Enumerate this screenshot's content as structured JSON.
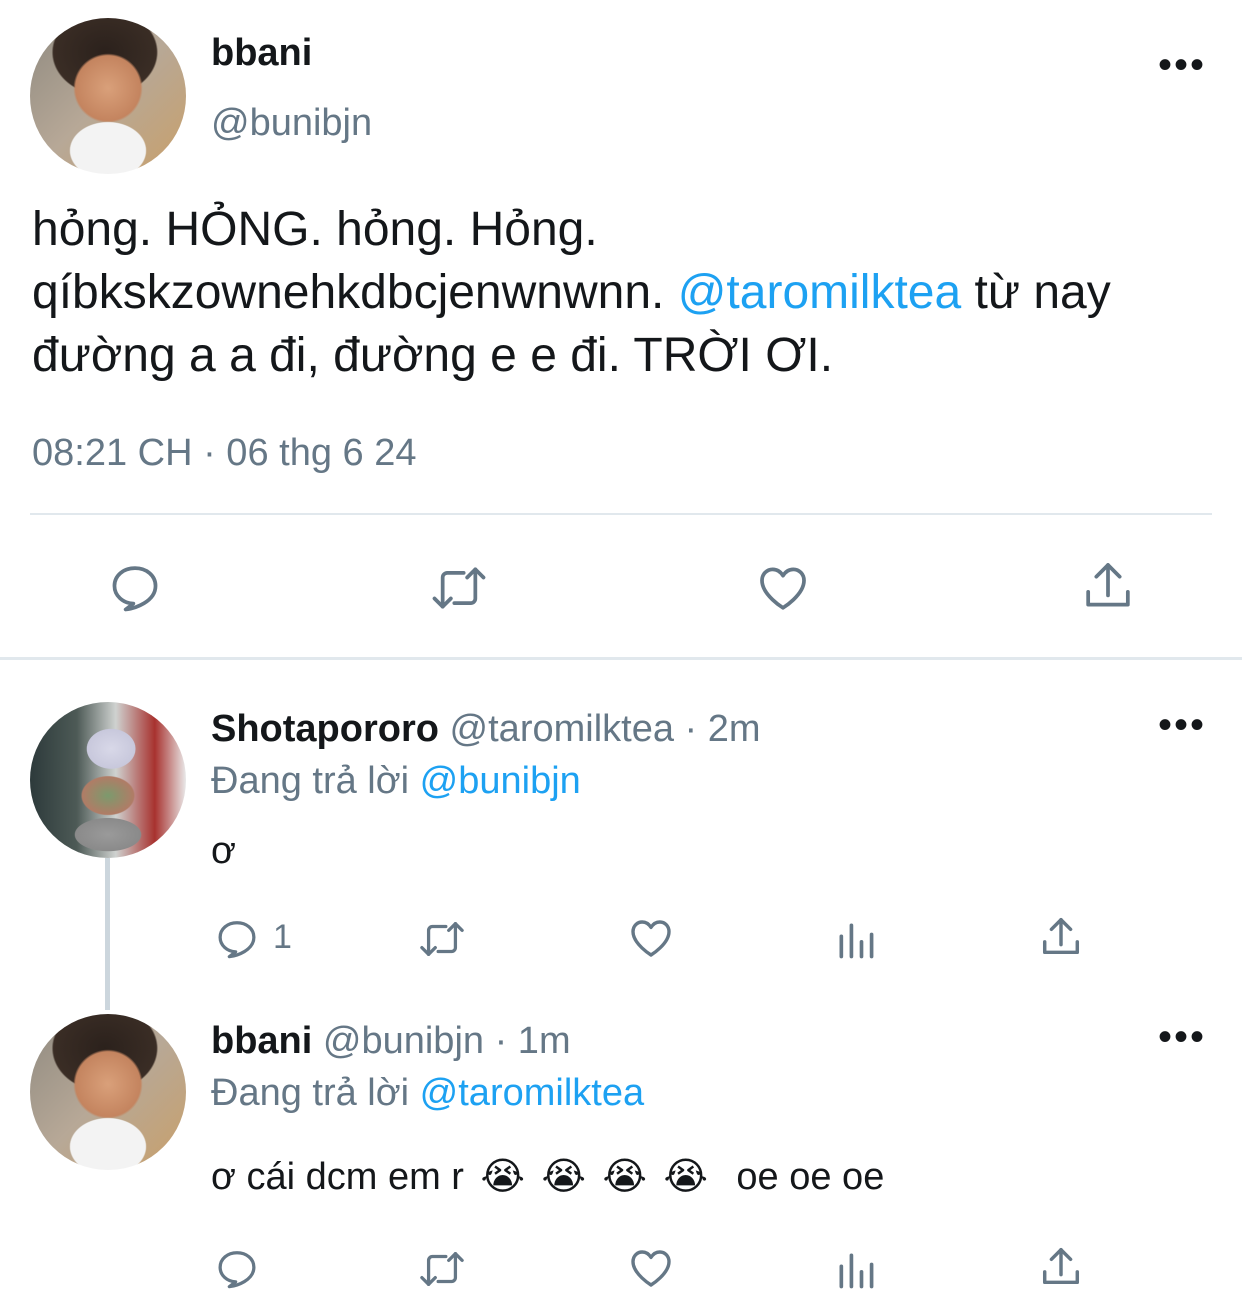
{
  "main_tweet": {
    "display_name": "bbani",
    "handle": "@bunibjn",
    "text_before": "hỏng. HỎNG. hỏng. Hỏng. qíbkskzownehkdbcjenwnwnn. ",
    "mention": "@taromilktea",
    "text_after": " từ nay đường a a đi, đường e e đi. TRỜI ƠI.",
    "timestamp": "08:21 CH · 06 thg 6 24"
  },
  "reply1": {
    "display_name": "Shotapororo",
    "handle": "@taromilktea",
    "time": "· 2m",
    "replying_label": "Đang trả lời",
    "replying_to": "@bunibjn",
    "text": "ơ",
    "reply_count": "1"
  },
  "reply2": {
    "display_name": "bbani",
    "handle": "@bunibjn",
    "time": "· 1m",
    "replying_label": "Đang trả lời",
    "replying_to": "@taromilktea",
    "text": "ơ cái dcm em r",
    "emojis": [
      "😭",
      "😭",
      "😭",
      "😭"
    ],
    "text_tail": "oe oe oe"
  },
  "colors": {
    "accent": "#1da1f2",
    "muted": "#657786",
    "text": "#14171a",
    "divider": "#e1e8ed"
  }
}
